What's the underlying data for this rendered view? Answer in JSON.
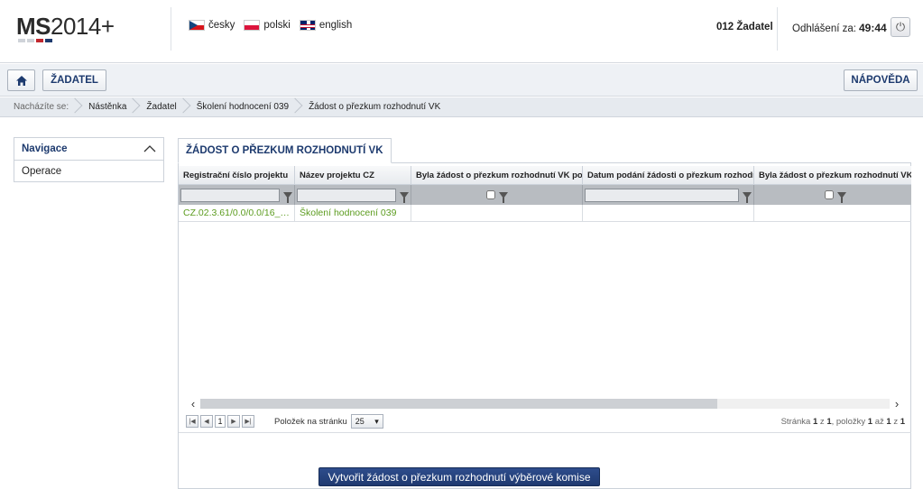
{
  "header": {
    "logo_main": "MS",
    "logo_suffix": "2014+",
    "logo_colors": [
      "#cfd3d9",
      "#cfd3d9",
      "#c1272d",
      "#1d3a6e"
    ],
    "languages": [
      {
        "label": "česky",
        "flag": "cz-flag-icon"
      },
      {
        "label": "polski",
        "flag": "pl-flag-icon"
      },
      {
        "label": "english",
        "flag": "uk-flag-icon"
      }
    ],
    "user": "012 Žadatel",
    "logout_label": "Odhlášení za:",
    "logout_time": "49:44",
    "power_icon": "power-icon"
  },
  "toolbar": {
    "home_icon": "home-icon",
    "zadatel_label": "ŽADATEL",
    "help_label": "NÁPOVĚDA"
  },
  "breadcrumb": {
    "prefix": "Nacházíte se:",
    "items": [
      "Nástěnka",
      "Žadatel",
      "Školení hodnocení 039",
      "Žádost o přezkum rozhodnutí VK"
    ]
  },
  "nav": {
    "title": "Navigace",
    "items": [
      "Operace"
    ]
  },
  "main": {
    "tab_label": "ŽÁDOST O PŘEZKUM ROZHODNUTÍ VK",
    "columns": [
      "Registrační číslo projektu",
      "Název projektu CZ",
      "Byla žádost o přezkum rozhodnutí VK podána?",
      "Datum podání žádosti o přezkum rozhodnutí VK",
      "Byla žádost o přezkum rozhodnutí VK vypořádána?"
    ],
    "rows": [
      [
        "CZ.02.3.61/0.0/0.0/16_02...",
        "Školení hodnocení 039",
        "",
        "",
        ""
      ]
    ],
    "pager": {
      "page": "1",
      "per_page_label": "Položek na stránku",
      "per_page": "25",
      "info_page": "Stránka",
      "info_page_num": "1",
      "info_of": "z",
      "info_total": "1",
      "info_items": ", položky",
      "info_from": "1",
      "info_to_label": "až",
      "info_to": "1",
      "info_of2": "z",
      "info_count": "1"
    },
    "create_button": "Vytvořit žádost o přezkum rozhodnutí výběrové komise"
  }
}
